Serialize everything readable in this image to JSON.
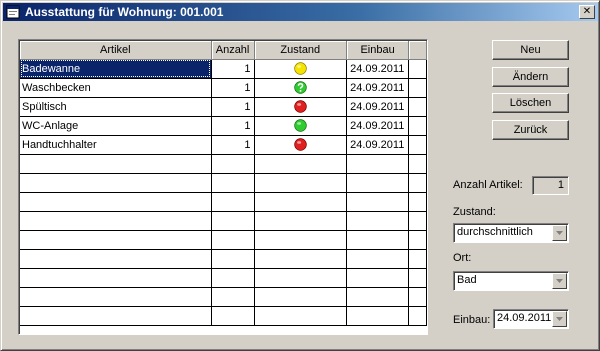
{
  "window": {
    "title": "Ausstattung für Wohnung:  001.001",
    "close_glyph": "✕"
  },
  "grid": {
    "columns": [
      "Artikel",
      "Anzahl",
      "Zustand",
      "Einbau"
    ],
    "rows": [
      {
        "artikel": "Badewanne",
        "anzahl": "1",
        "zustand": "yellow",
        "einbau": "24.09.2011"
      },
      {
        "artikel": "Waschbecken",
        "anzahl": "1",
        "zustand": "question",
        "einbau": "24.09.2011"
      },
      {
        "artikel": "Spültisch",
        "anzahl": "1",
        "zustand": "red",
        "einbau": "24.09.2011"
      },
      {
        "artikel": "WC-Anlage",
        "anzahl": "1",
        "zustand": "green",
        "einbau": "24.09.2011"
      },
      {
        "artikel": "Handtuchhalter",
        "anzahl": "1",
        "zustand": "red",
        "einbau": "24.09.2011"
      }
    ],
    "selected_row": 0
  },
  "buttons": {
    "neu": "Neu",
    "aendern": "Ändern",
    "loeschen": "Löschen",
    "zurueck": "Zurück"
  },
  "details": {
    "anzahl_label": "Anzahl Artikel:",
    "anzahl_value": "1",
    "zustand_label": "Zustand:",
    "zustand_value": "durchschnittlich",
    "ort_label": "Ort:",
    "ort_value": "Bad",
    "einbau_label": "Einbau:",
    "einbau_value": "24.09.2011"
  },
  "colors": {
    "titlebar": "#0a246a",
    "selection": "#0a246a",
    "status_yellow": "#f5e400",
    "status_green": "#2ecc2e",
    "status_red": "#e02020"
  }
}
